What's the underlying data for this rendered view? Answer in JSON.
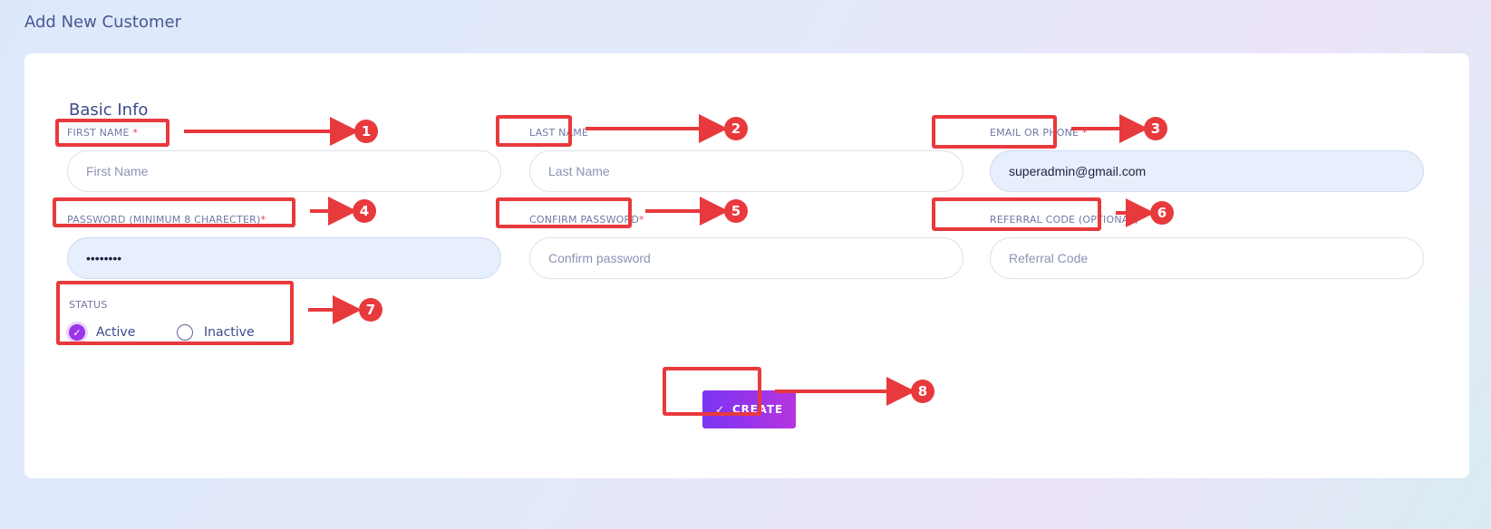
{
  "page": {
    "title": "Add New Customer"
  },
  "form": {
    "section_title": "Basic Info",
    "required_mark": "*",
    "fields": {
      "first_name": {
        "label": "FIRST NAME ",
        "placeholder": "First Name",
        "value": ""
      },
      "last_name": {
        "label": "LAST NAME",
        "placeholder": "Last Name",
        "value": ""
      },
      "email_or_phone": {
        "label": "EMAIL OR PHONE ",
        "placeholder": "",
        "value": "superadmin@gmail.com"
      },
      "password": {
        "label": "PASSWORD (MINIMUM 8 CHARECTER)",
        "placeholder": "",
        "value": "••••••••"
      },
      "confirm_password": {
        "label": "CONFIRM PASSWORD",
        "placeholder": "Confirm password",
        "value": ""
      },
      "referral_code": {
        "label": "REFERRAL CODE (OPTIONAL)",
        "placeholder": "Referral Code",
        "value": ""
      }
    },
    "status": {
      "label": "STATUS",
      "options": [
        {
          "label": "Active",
          "selected": true
        },
        {
          "label": "Inactive",
          "selected": false
        }
      ]
    },
    "submit": {
      "icon": "check-icon",
      "glyph": "✓",
      "label": "CREATE"
    }
  },
  "annotations": {
    "color": "#e8393d",
    "badges": [
      "1",
      "2",
      "3",
      "4",
      "5",
      "6",
      "7",
      "8"
    ]
  }
}
